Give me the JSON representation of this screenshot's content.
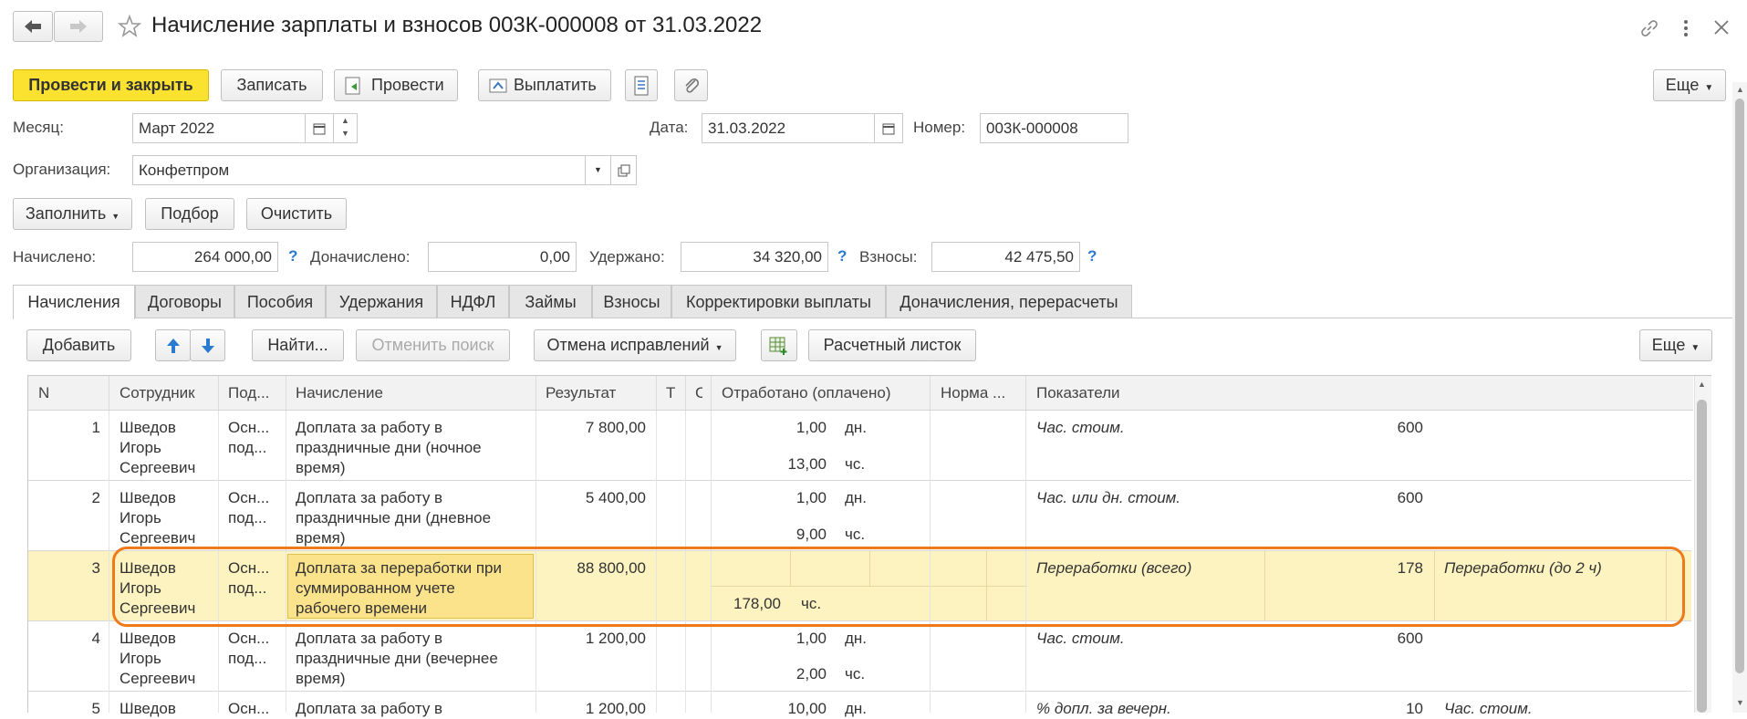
{
  "window": {
    "title": "Начисление зарплаты и взносов 003К-000008 от 31.03.2022"
  },
  "toolbar": {
    "post_close": "Провести и закрыть",
    "save": "Записать",
    "post": "Провести",
    "pay": "Выплатить",
    "more": "Еще"
  },
  "form": {
    "month_label": "Месяц:",
    "month_value": "Март 2022",
    "date_label": "Дата:",
    "date_value": "31.03.2022",
    "number_label": "Номер:",
    "number_value": "003К-000008",
    "org_label": "Организация:",
    "org_value": "Конфетпром"
  },
  "actions": {
    "fill": "Заполнить",
    "select": "Подбор",
    "clear": "Очистить"
  },
  "totals": {
    "accrued_label": "Начислено:",
    "accrued_value": "264 000,00",
    "extra_label": "Доначислено:",
    "extra_value": "0,00",
    "withheld_label": "Удержано:",
    "withheld_value": "34 320,00",
    "contrib_label": "Взносы:",
    "contrib_value": "42 475,50",
    "help": "?"
  },
  "tabs": [
    "Начисления",
    "Договоры",
    "Пособия",
    "Удержания",
    "НДФЛ",
    "Займы",
    "Взносы",
    "Корректировки выплаты",
    "Доначисления, перерасчеты"
  ],
  "table_toolbar": {
    "add": "Добавить",
    "find": "Найти...",
    "cancel_search": "Отменить поиск",
    "cancel_fix": "Отмена исправлений",
    "payslip": "Расчетный листок",
    "more": "Еще"
  },
  "columns": {
    "n": "N",
    "employee": "Сотрудник",
    "division": "Под...",
    "accrual": "Начисление",
    "result": "Результат",
    "t": "Т",
    "c": "С",
    "worked": "Отработано (оплачено)",
    "norm": "Норма ...",
    "indicators": "Показатели"
  },
  "rows": [
    {
      "n": "1",
      "emp": [
        "Шведов",
        "Игорь",
        "Сергеевич"
      ],
      "div": [
        "Осн...",
        "под..."
      ],
      "accrual": [
        "Доплата за работу в",
        "праздничные дни (ночное",
        "время)"
      ],
      "result": "7 800,00",
      "w1": "1,00",
      "u1": "дн.",
      "w2": "13,00",
      "u2": "чс.",
      "ind_name": "Час. стоим.",
      "ind_val": "600",
      "ind2_name": ""
    },
    {
      "n": "2",
      "emp": [
        "Шведов",
        "Игорь",
        "Сергеевич"
      ],
      "div": [
        "Осн...",
        "под..."
      ],
      "accrual": [
        "Доплата за работу в",
        "праздничные дни (дневное",
        "время)"
      ],
      "result": "5 400,00",
      "w1": "1,00",
      "u1": "дн.",
      "w2": "9,00",
      "u2": "чс.",
      "ind_name": "Час. или дн. стоим.",
      "ind_val": "600",
      "ind2_name": ""
    },
    {
      "n": "3",
      "emp": [
        "Шведов",
        "Игорь",
        "Сергеевич"
      ],
      "div": [
        "Осн...",
        "под..."
      ],
      "accrual": [
        "Доплата за переработки при",
        "суммированном учете",
        "рабочего времени"
      ],
      "result": "88 800,00",
      "w1": "",
      "u1": "",
      "w2": "178,00",
      "u2": "чс.",
      "ind_name": "Переработки (всего)",
      "ind_val": "178",
      "ind2_name": "Переработки (до 2 ч)"
    },
    {
      "n": "4",
      "emp": [
        "Шведов",
        "Игорь",
        "Сергеевич"
      ],
      "div": [
        "Осн...",
        "под..."
      ],
      "accrual": [
        "Доплата за работу в",
        "праздничные дни (вечернее",
        "время)"
      ],
      "result": "1 200,00",
      "w1": "1,00",
      "u1": "дн.",
      "w2": "2,00",
      "u2": "чс.",
      "ind_name": "Час. стоим.",
      "ind_val": "600",
      "ind2_name": ""
    },
    {
      "n": "5",
      "emp": [
        "Шведов"
      ],
      "div": [
        "Осн..."
      ],
      "accrual": [
        "Доплата за работу в"
      ],
      "result": "1 200,00",
      "w1": "10,00",
      "u1": "дн.",
      "w2": "",
      "u2": "",
      "ind_name": "% допл. за вечерн.",
      "ind_val": "10",
      "ind2_name": "Час. стоим."
    }
  ],
  "colors": {
    "primary_button": "#fbe231",
    "selected_row": "#fdf3c0",
    "active_cell": "#fbe38c",
    "highlight_outline": "#ee7a1c",
    "help_mark": "#2a7bd0"
  }
}
